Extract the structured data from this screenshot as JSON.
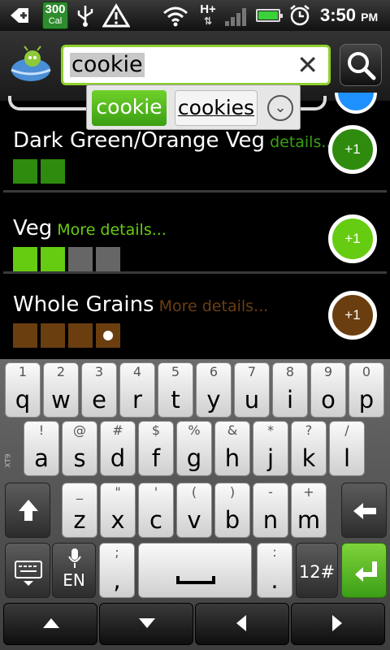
{
  "status_bar": {
    "calorie_count": "300",
    "calorie_unit": "Cal",
    "network_type": "H+",
    "time": "3:50",
    "time_period": "PM"
  },
  "search": {
    "query": "cookie"
  },
  "suggestions": {
    "items": [
      "cookie",
      "cookies"
    ],
    "selected": "cookie"
  },
  "food_groups": [
    {
      "name": "Dark Green/Orange Veg",
      "details": "details...",
      "color": "#2e8b0e",
      "filled": 2,
      "total": 2,
      "add_label": "+1"
    },
    {
      "name": "Veg",
      "details": "More details...",
      "color": "#66cc11",
      "filled": 2,
      "total": 4,
      "add_label": "+1"
    },
    {
      "name": "Whole Grains",
      "details": "More details...",
      "color": "#6b3e10",
      "filled": 3,
      "total": 4,
      "add_label": "+1"
    }
  ],
  "keyboard": {
    "row1": [
      {
        "pri": "q",
        "sec": "1"
      },
      {
        "pri": "w",
        "sec": "2"
      },
      {
        "pri": "e",
        "sec": "3"
      },
      {
        "pri": "r",
        "sec": "4"
      },
      {
        "pri": "t",
        "sec": "5"
      },
      {
        "pri": "y",
        "sec": "6"
      },
      {
        "pri": "u",
        "sec": "7"
      },
      {
        "pri": "i",
        "sec": "8"
      },
      {
        "pri": "o",
        "sec": "9"
      },
      {
        "pri": "p",
        "sec": "0"
      }
    ],
    "row2": [
      {
        "pri": "a",
        "sec": "!"
      },
      {
        "pri": "s",
        "sec": "@"
      },
      {
        "pri": "d",
        "sec": "#"
      },
      {
        "pri": "f",
        "sec": "$"
      },
      {
        "pri": "g",
        "sec": "%"
      },
      {
        "pri": "h",
        "sec": "&"
      },
      {
        "pri": "j",
        "sec": "*"
      },
      {
        "pri": "k",
        "sec": "?"
      },
      {
        "pri": "l",
        "sec": "/"
      }
    ],
    "row3": [
      {
        "pri": "z",
        "sec": "_"
      },
      {
        "pri": "x",
        "sec": "\""
      },
      {
        "pri": "c",
        "sec": "'"
      },
      {
        "pri": "v",
        "sec": "("
      },
      {
        "pri": "b",
        "sec": ")"
      },
      {
        "pri": "n",
        "sec": "-"
      },
      {
        "pri": "m",
        "sec": "+"
      }
    ],
    "row4": {
      "lang": "EN",
      "comma": ",",
      "comma_sec": ";",
      "period": ".",
      "period_sec": ":",
      "symbols": "12#"
    },
    "side_label": "XT9"
  }
}
